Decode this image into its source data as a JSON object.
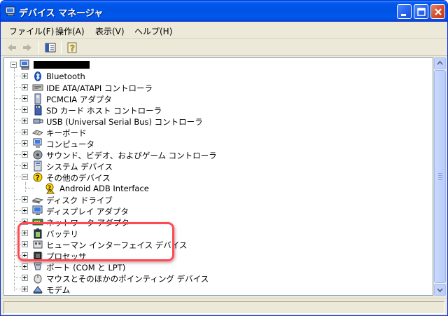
{
  "window": {
    "title": "デバイス マネージャ"
  },
  "menu": [
    {
      "label": "ファイル(F)"
    },
    {
      "label": "操作(A)"
    },
    {
      "label": "表示(V)"
    },
    {
      "label": "ヘルプ(H)"
    }
  ],
  "toolbar": {
    "icons": [
      "back-arrow-icon",
      "forward-arrow-icon",
      "properties-icon",
      "help-icon"
    ]
  },
  "tree": {
    "root": {
      "icon": "computer-icon",
      "label_redacted": true
    },
    "items": [
      {
        "label": "Bluetooth",
        "icon": "bluetooth-icon"
      },
      {
        "label": "IDE ATA/ATAPI コントローラ",
        "icon": "ide-controller-icon"
      },
      {
        "label": "PCMCIA アダプタ",
        "icon": "pcmcia-icon"
      },
      {
        "label": "SD カード ホスト コントローラ",
        "icon": "sd-card-icon"
      },
      {
        "label": "USB (Universal Serial Bus) コントローラ",
        "icon": "usb-icon"
      },
      {
        "label": "キーボード",
        "icon": "keyboard-icon"
      },
      {
        "label": "コンピュータ",
        "icon": "computer-icon"
      },
      {
        "label": "サウンド、ビデオ、およびゲーム コントローラ",
        "icon": "sound-icon"
      },
      {
        "label": "システム デバイス",
        "icon": "system-device-icon"
      },
      {
        "label": "その他のデバイス",
        "icon": "unknown-device-icon",
        "expanded": true,
        "children": [
          {
            "label": "Android ADB Interface",
            "icon": "warning-device-icon"
          }
        ]
      },
      {
        "label": "ディスク ドライブ",
        "icon": "disk-drive-icon"
      },
      {
        "label": "ディスプレイ アダプタ",
        "icon": "display-adapter-icon"
      },
      {
        "label": "ネットワーク アダプタ",
        "icon": "network-adapter-icon"
      },
      {
        "label": "バッテリ",
        "icon": "battery-icon"
      },
      {
        "label": "ヒューマン インターフェイス デバイス",
        "icon": "hid-icon"
      },
      {
        "label": "プロセッサ",
        "icon": "processor-icon"
      },
      {
        "label": "ポート (COM と LPT)",
        "icon": "port-icon"
      },
      {
        "label": "マウスとそのほかのポインティング デバイス",
        "icon": "mouse-icon"
      },
      {
        "label": "モデム",
        "icon": "modem-icon"
      }
    ]
  },
  "colors": {
    "highlight": "#ff4a55",
    "titlebar": "#0054e3",
    "chrome": "#ece9d8"
  }
}
